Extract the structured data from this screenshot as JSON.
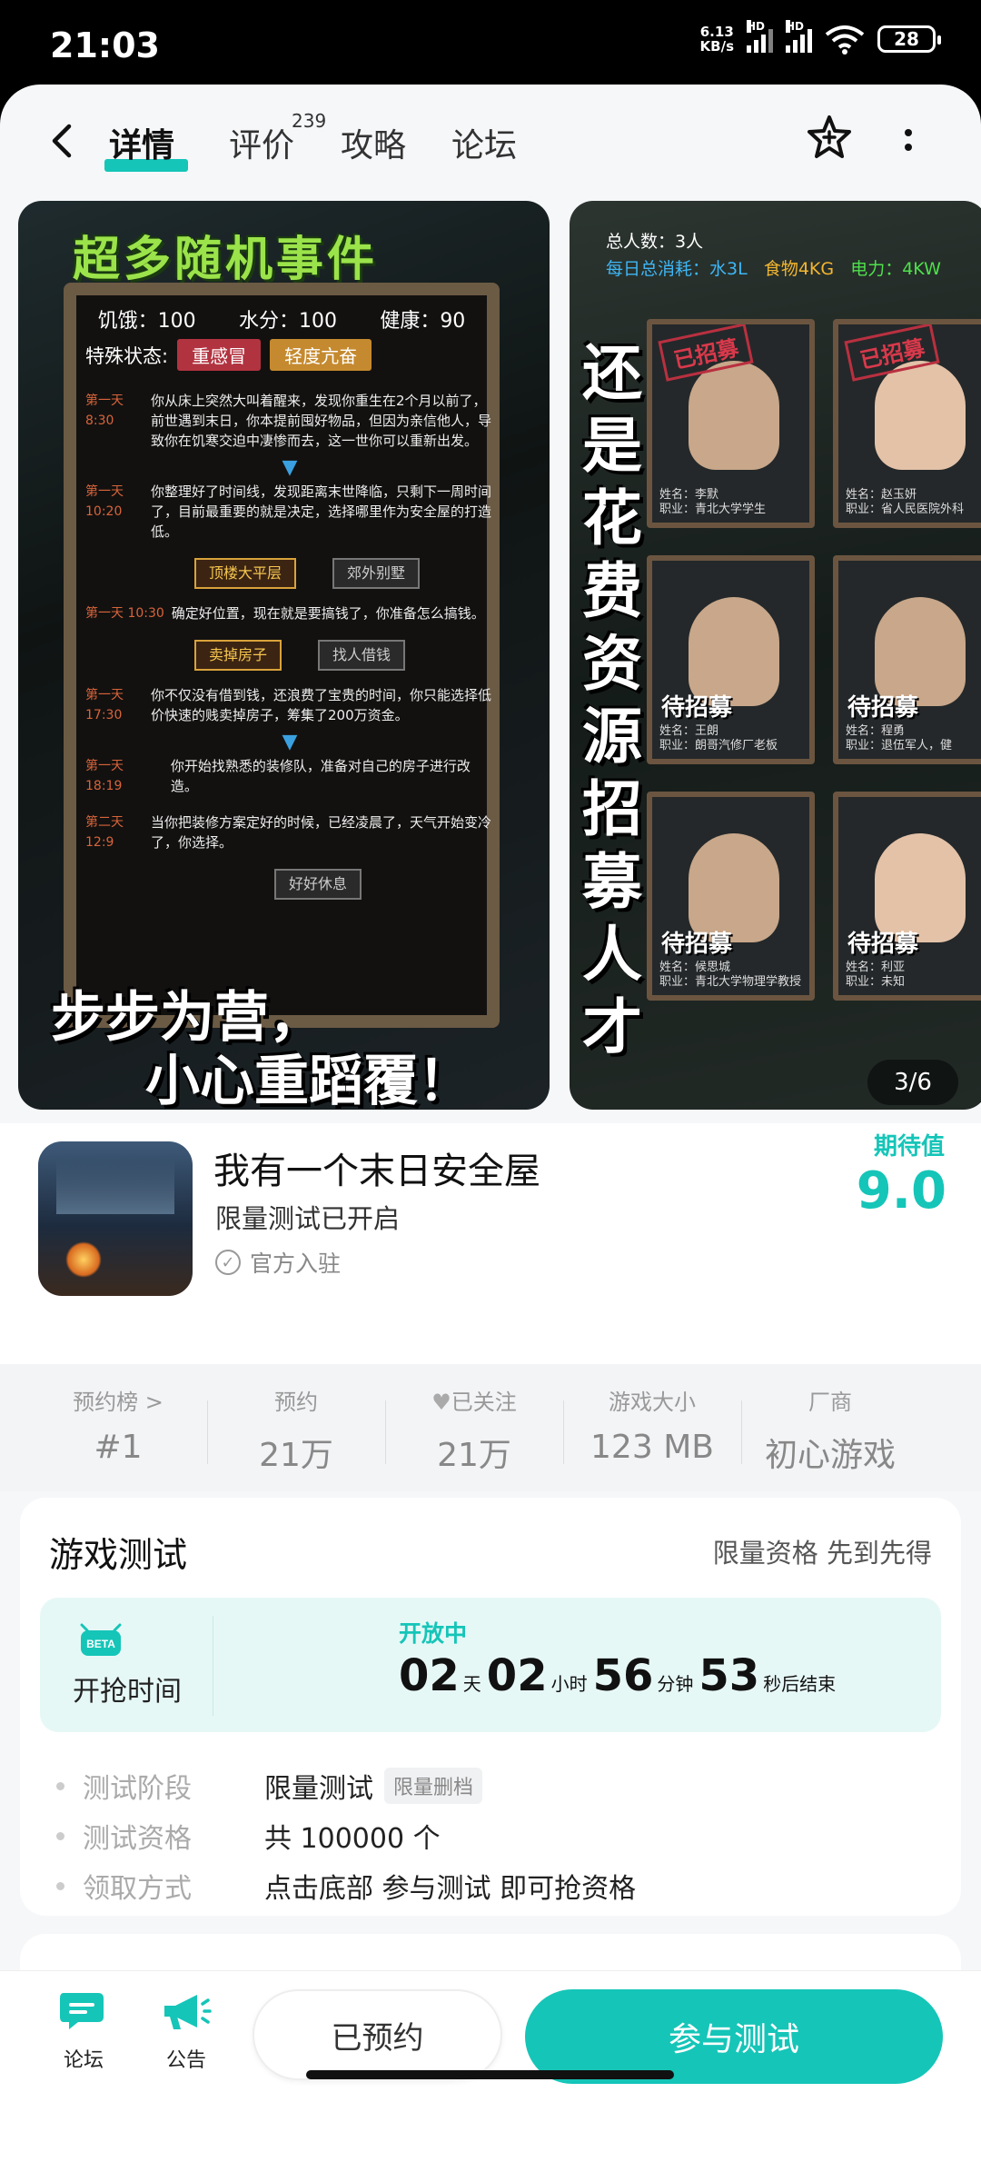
{
  "status_bar": {
    "time": "21:03",
    "speed_top": "6.13",
    "speed_bottom": "KB/s",
    "hd1": "HD",
    "hd2": "HD",
    "battery": "28"
  },
  "nav": {
    "tabs": [
      {
        "label": "详情",
        "active": true
      },
      {
        "label": "评价",
        "badge": "239"
      },
      {
        "label": "攻略"
      },
      {
        "label": "论坛"
      }
    ]
  },
  "screenshots": {
    "shot1": {
      "title": "超多随机事件",
      "stats": [
        "饥饿：100",
        "水分：100",
        "健康：90"
      ],
      "status_label": "特殊状态:",
      "status_tags": [
        "重感冒",
        "轻度亢奋"
      ],
      "log": [
        {
          "day": "第一天 8:30",
          "text": "你从床上突然大叫着醒来，发现你重生在2个月以前了，前世遇到末日，你本提前囤好物品，但因为亲信他人，导致你在饥寒交迫中凄惨而去，这一世你可以重新出发。"
        },
        {
          "day": "第一天 10:20",
          "text": "你整理好了时间线，发现距离末世降临，只剩下一周时间了，目前最重要的就是决定，选择哪里作为安全屋的打造低。"
        },
        {
          "day": "第一天 10:30",
          "text": "确定好位置，现在就是要搞钱了，你准备怎么搞钱。"
        },
        {
          "day": "第一天 17:30",
          "text": "你不仅没有借到钱，还浪费了宝贵的时间，你只能选择低价快速的贱卖掉房子，筹集了200万资金。"
        },
        {
          "day": "第一天 18:19",
          "text": "你开始找熟悉的装修队，准备对自己的房子进行改造。"
        },
        {
          "day": "第二天 12:9",
          "text": "当你把装修方案定好的时候，已经凌晨了，天气开始变冷了，你选择。"
        }
      ],
      "choices": [
        [
          "顶楼大平层",
          "郊外别墅"
        ],
        [
          "卖掉房子",
          "找人借钱"
        ],
        [
          "",
          "好好休息"
        ]
      ],
      "slogan1": "步步为营，",
      "slogan2": "小心重蹈覆！"
    },
    "shot2": {
      "info_line1": "总人数：3人",
      "info_consume": "每日总消耗：水3L",
      "info_food": "食物4KG",
      "info_power": "电力：4KW",
      "vertical": "还是花费资源招募人才",
      "stamp": "已招募",
      "wait": "待招募",
      "cards": [
        {
          "stamp": "已招募",
          "name": "姓名：李默",
          "job": "职业：青北大学学生"
        },
        {
          "stamp": "已招募",
          "name": "姓名：赵玉妍",
          "job": "职业：省人民医院外科"
        },
        {
          "wait": "待招募",
          "name": "姓名：王朗",
          "job": "职业：朗哥汽修厂老板"
        },
        {
          "wait": "待招募",
          "name": "姓名：程勇",
          "job": "职业：退伍军人，健"
        },
        {
          "wait": "待招募",
          "name": "姓名：候思城",
          "job": "职业：青北大学物理学教授"
        },
        {
          "wait": "待招募",
          "name": "姓名：利亚",
          "job": "职业：未知"
        }
      ]
    },
    "page_indicator": "3/6"
  },
  "app": {
    "name": "我有一个末日安全屋",
    "subtitle": "限量测试已开启",
    "official": "官方入驻",
    "expect_label": "期待值",
    "expect_value": "9.0"
  },
  "stats": [
    {
      "label": "预约榜 >",
      "value": "#1"
    },
    {
      "label": "预约",
      "value": "21万"
    },
    {
      "label": "已关注",
      "value": "21万"
    },
    {
      "label": "游戏大小",
      "value": "123 MB"
    },
    {
      "label": "厂商",
      "value": "初心游戏"
    }
  ],
  "test": {
    "title": "游戏测试",
    "right": "限量资格 先到先得",
    "beta_badge": "BETA",
    "beta_label": "开抢时间",
    "open": "开放中",
    "countdown": {
      "days": "02",
      "day_unit": "天",
      "hours": "02",
      "hour_unit": "小时",
      "minutes": "56",
      "min_unit": "分钟",
      "seconds": "53",
      "sec_unit": "秒后结束"
    },
    "details": [
      {
        "key": "测试阶段",
        "value": "限量测试",
        "tag": "限量删档"
      },
      {
        "key": "测试资格",
        "value": "共 100000 个"
      },
      {
        "key": "领取方式",
        "value": "点击底部 参与测试 即可抢资格"
      }
    ]
  },
  "bottom": {
    "forum": "论坛",
    "notice": "公告",
    "reserved": "已预约",
    "join": "参与测试"
  },
  "colors": {
    "accent": "#15c5b8"
  }
}
